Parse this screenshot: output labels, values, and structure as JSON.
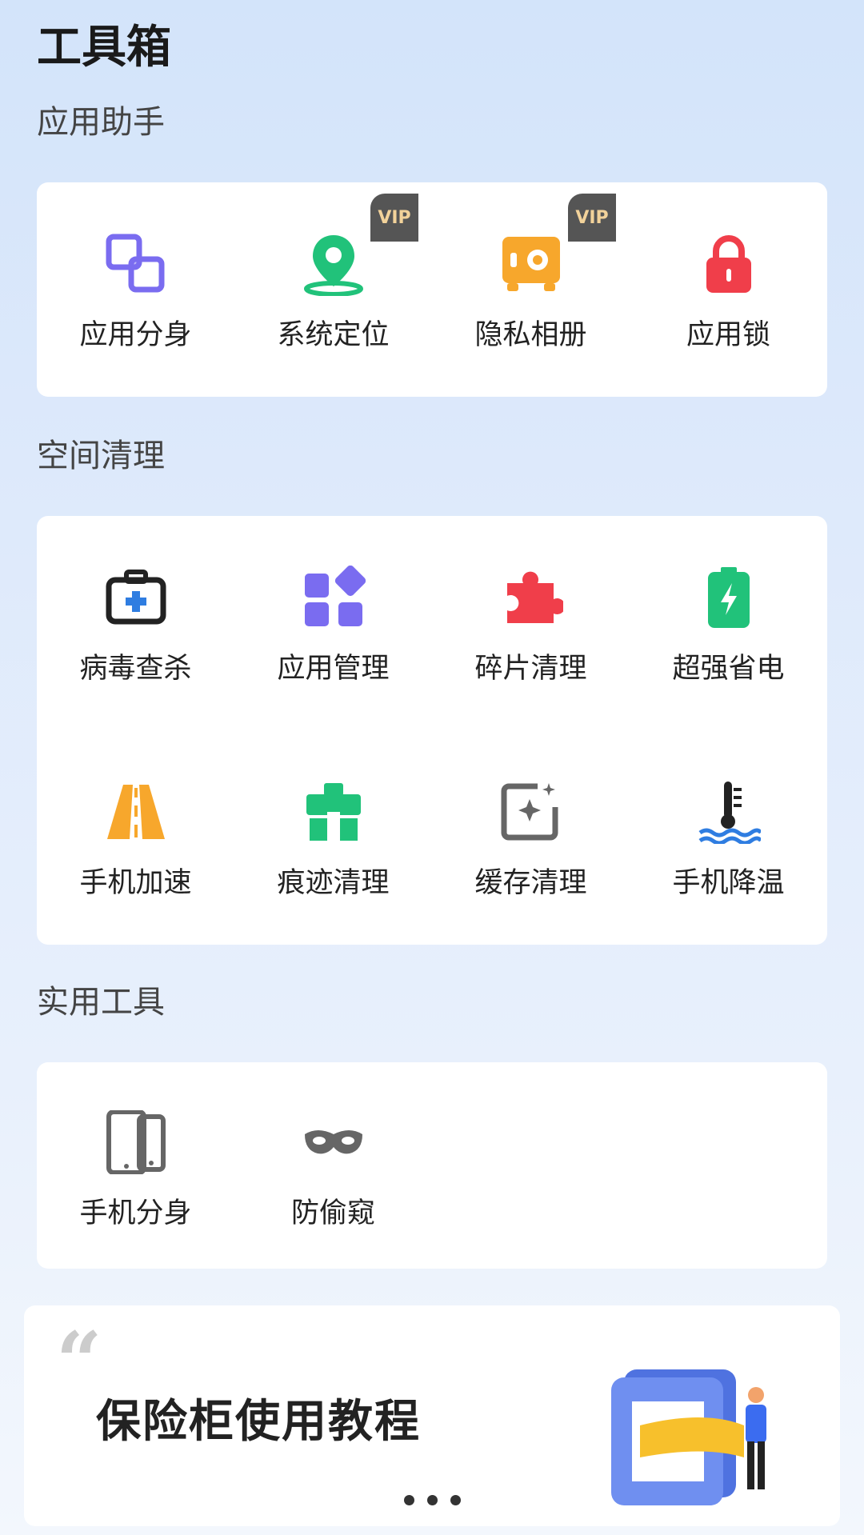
{
  "header": {
    "title": "工具箱"
  },
  "sections": [
    {
      "title": "应用助手",
      "items": [
        {
          "label": "应用分身",
          "icon": "app-clone-icon",
          "vip": false
        },
        {
          "label": "系统定位",
          "icon": "location-pin-icon",
          "vip": true
        },
        {
          "label": "隐私相册",
          "icon": "private-album-icon",
          "vip": true
        },
        {
          "label": "应用锁",
          "icon": "lock-icon",
          "vip": false
        }
      ]
    },
    {
      "title": "空间清理",
      "items": [
        {
          "label": "病毒查杀",
          "icon": "medkit-icon"
        },
        {
          "label": "应用管理",
          "icon": "app-grid-icon"
        },
        {
          "label": "碎片清理",
          "icon": "puzzle-icon"
        },
        {
          "label": "超强省电",
          "icon": "battery-icon"
        },
        {
          "label": "手机加速",
          "icon": "road-icon"
        },
        {
          "label": "痕迹清理",
          "icon": "toolbox-icon"
        },
        {
          "label": "缓存清理",
          "icon": "sparkle-frame-icon"
        },
        {
          "label": "手机降温",
          "icon": "thermometer-icon"
        }
      ]
    },
    {
      "title": "实用工具",
      "items": [
        {
          "label": "手机分身",
          "icon": "dual-phone-icon"
        },
        {
          "label": "防偷窥",
          "icon": "mask-icon"
        }
      ]
    }
  ],
  "badge": {
    "vip_label": "VIP"
  },
  "banner": {
    "title": "保险柜使用教程",
    "quote_mark": "“"
  },
  "colors": {
    "purple": "#7a6cf0",
    "green": "#21c27a",
    "orange": "#f7a72c",
    "red": "#f03e4a",
    "blue": "#2f7de1"
  }
}
